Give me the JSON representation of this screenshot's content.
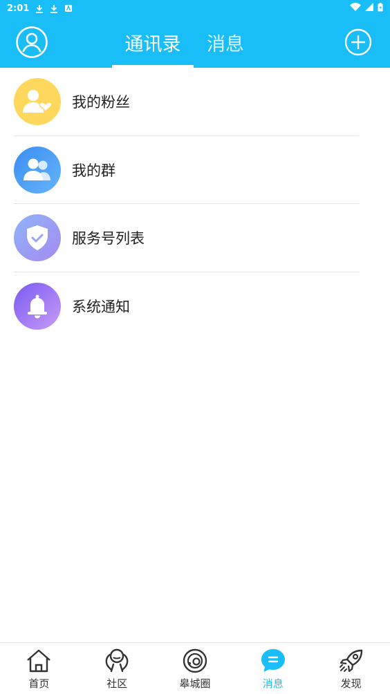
{
  "status_bar": {
    "time": "2:01"
  },
  "header": {
    "tabs": [
      {
        "label": "通讯录",
        "active": true
      },
      {
        "label": "消息",
        "active": false
      }
    ]
  },
  "list": {
    "items": [
      {
        "label": "我的粉丝",
        "icon": "fans-icon",
        "color": "#fdd85c"
      },
      {
        "label": "我的群",
        "icon": "group-icon",
        "color": "#3c8df0"
      },
      {
        "label": "服务号列表",
        "icon": "shield-check-icon",
        "color": "#a58bf2"
      },
      {
        "label": "系统通知",
        "icon": "bell-icon",
        "color": "#7a5af0"
      }
    ]
  },
  "bottom_nav": {
    "items": [
      {
        "label": "首页",
        "icon": "home-icon"
      },
      {
        "label": "社区",
        "icon": "community-icon"
      },
      {
        "label": "皋城圈",
        "icon": "circle-icon"
      },
      {
        "label": "消息",
        "icon": "chat-icon",
        "active": true
      },
      {
        "label": "发现",
        "icon": "rocket-icon"
      }
    ]
  },
  "colors": {
    "primary": "#19bdf7"
  }
}
